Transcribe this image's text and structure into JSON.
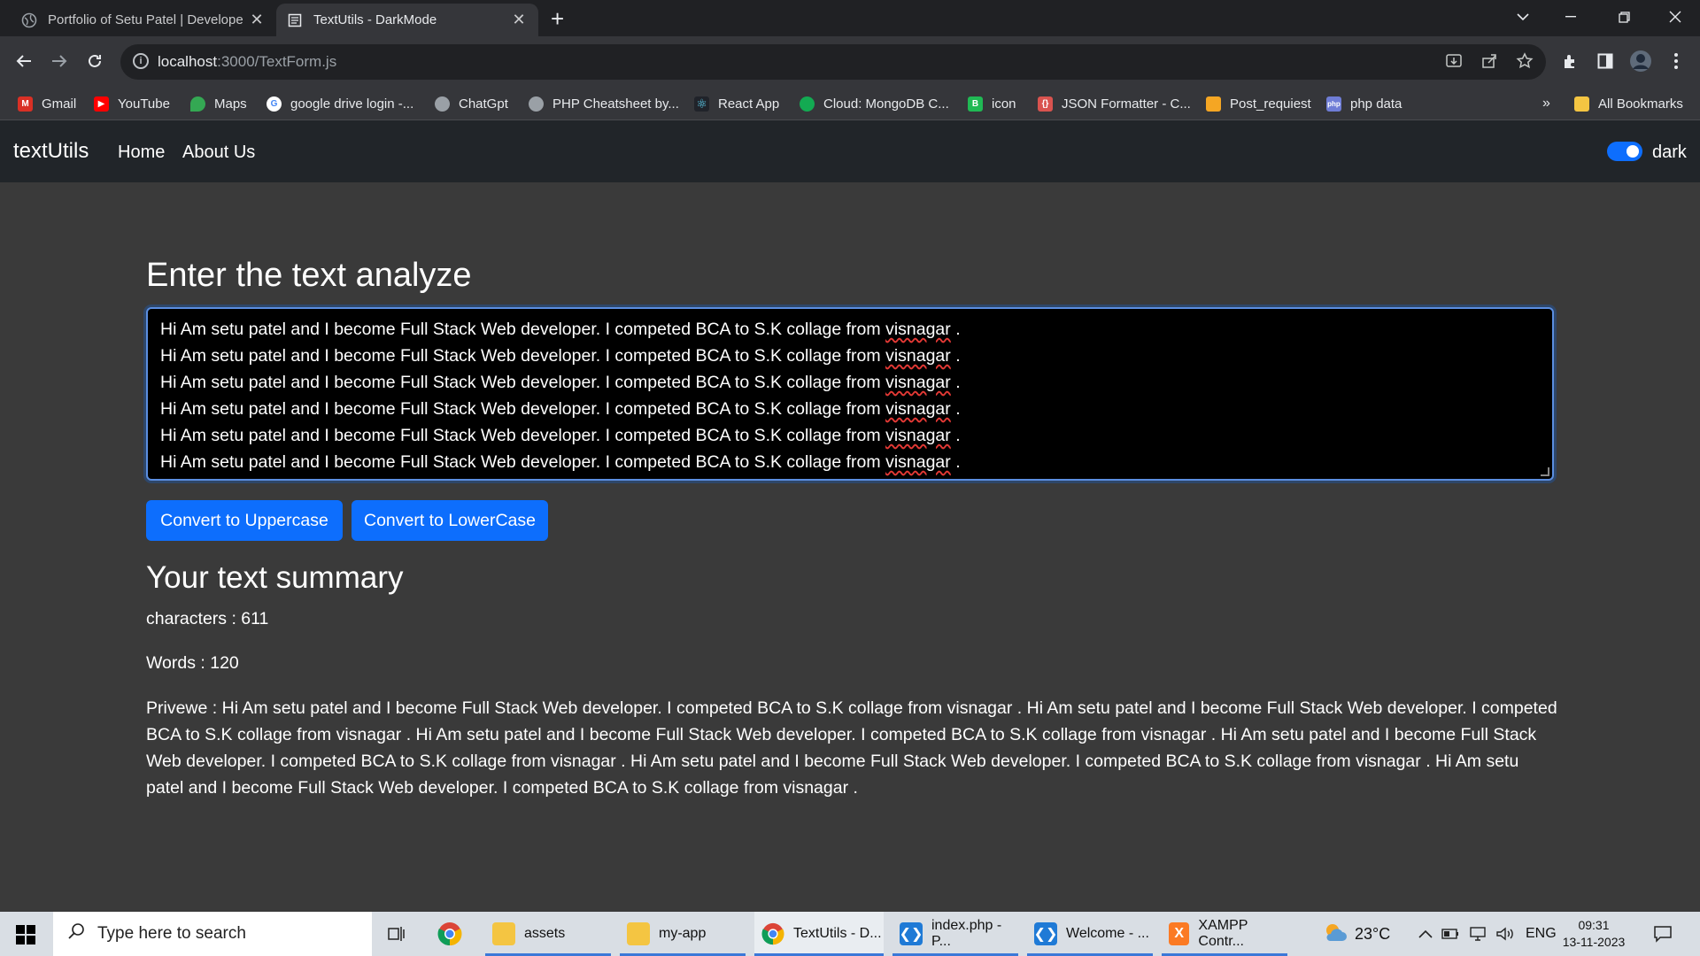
{
  "browser": {
    "tabs": [
      {
        "title": "Portfolio of Setu Patel | Develope",
        "active": false
      },
      {
        "title": "TextUtils - DarkMode",
        "active": true
      }
    ],
    "new_tab": "+",
    "url_host": "localhost",
    "url_path": ":3000/TextForm.js",
    "bookmarks": [
      {
        "label": "Gmail",
        "icon": "gmail-icon",
        "color": "#d93025"
      },
      {
        "label": "YouTube",
        "icon": "youtube-icon",
        "color": "#ff0000"
      },
      {
        "label": "Maps",
        "icon": "maps-icon",
        "color": "#34a853"
      },
      {
        "label": "google drive login -...",
        "icon": "google-icon",
        "color": "#4285f4"
      },
      {
        "label": "ChatGpt",
        "icon": "globe-icon",
        "color": "#9aa0a6"
      },
      {
        "label": "PHP Cheatsheet by...",
        "icon": "globe-icon",
        "color": "#9aa0a6"
      },
      {
        "label": "React App",
        "icon": "react-icon",
        "color": "#61dafb"
      },
      {
        "label": "Cloud: MongoDB C...",
        "icon": "mongodb-icon",
        "color": "#13aa52"
      },
      {
        "label": "icon",
        "icon": "icon-site-icon",
        "color": "#20b954"
      },
      {
        "label": "JSON Formatter - C...",
        "icon": "json-formatter-icon",
        "color": "#d9534f"
      },
      {
        "label": "Post_requiest",
        "icon": "page-icon",
        "color": "#f5a623"
      },
      {
        "label": "php data",
        "icon": "php-icon",
        "color": "#6f7dd6"
      }
    ],
    "more_bookmarks": "»",
    "all_bookmarks": "All Bookmarks"
  },
  "navbar": {
    "brand": "textUtils",
    "links": [
      "Home",
      "About Us"
    ],
    "mode_label": "dark",
    "mode_on": true
  },
  "form": {
    "heading": "Enter the text analyze",
    "line_text": "Hi Am setu patel and I become Full Stack Web developer. I competed BCA to S.K collage from ",
    "squiggle_word": "visnagar",
    "line_end": " .",
    "buttons": [
      "Convert to Uppercase",
      "Convert to LowerCase"
    ]
  },
  "summary": {
    "heading": "Your text summary",
    "characters": "characters : 611",
    "words": "Words : 120",
    "preview": "Privewe : Hi Am setu patel and I become Full Stack Web developer. I competed BCA to S.K collage from visnagar . Hi Am setu patel and I become Full Stack Web developer. I competed BCA to S.K collage from visnagar . Hi Am setu patel and I become Full Stack Web developer. I competed BCA to S.K collage from visnagar . Hi Am setu patel and I become Full Stack Web developer. I competed BCA to S.K collage from visnagar . Hi Am setu patel and I become Full Stack Web developer. I competed BCA to S.K collage from visnagar . Hi Am setu patel and I become Full Stack Web developer. I competed BCA to S.K collage from visnagar ."
  },
  "taskbar": {
    "search_placeholder": "Type here to search",
    "items": [
      {
        "label": "assets",
        "icon": "folder-icon"
      },
      {
        "label": "my-app",
        "icon": "folder-icon"
      },
      {
        "label": "TextUtils - D...",
        "icon": "chrome-icon"
      },
      {
        "label": "index.php - P...",
        "icon": "vscode-icon"
      },
      {
        "label": "Welcome - ...",
        "icon": "vscode-icon"
      },
      {
        "label": "XAMPP Contr...",
        "icon": "xampp-icon"
      }
    ],
    "weather": "23°C",
    "language": "ENG",
    "time": "09:31",
    "date": "13-11-2023"
  }
}
